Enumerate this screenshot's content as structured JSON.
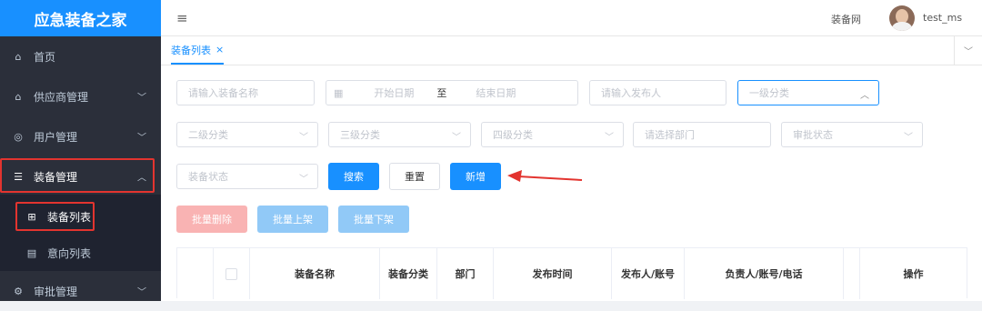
{
  "sidebar": {
    "logo": "应急装备之家",
    "items": [
      {
        "label": "首页",
        "icon": "home-icon"
      },
      {
        "label": "供应商管理",
        "icon": "home-icon"
      },
      {
        "label": "用户管理",
        "icon": "user-icon"
      },
      {
        "label": "装备管理",
        "icon": "menu-icon"
      },
      {
        "label": "装备列表",
        "icon": "grid-icon"
      },
      {
        "label": "意向列表",
        "icon": "document-icon"
      },
      {
        "label": "审批管理",
        "icon": "approval-icon"
      }
    ]
  },
  "header": {
    "site_name": "装备网",
    "username": "test_ms"
  },
  "tabs": [
    {
      "label": "装备列表",
      "close": "×"
    }
  ],
  "filters": {
    "equipment_name_placeholder": "请输入装备名称",
    "start_date_placeholder": "开始日期",
    "date_separator": "至",
    "end_date_placeholder": "结束日期",
    "publisher_placeholder": "请输入发布人",
    "level1_placeholder": "一级分类",
    "level2_placeholder": "二级分类",
    "level3_placeholder": "三级分类",
    "level4_placeholder": "四级分类",
    "department_placeholder": "请选择部门",
    "approval_status_placeholder": "审批状态",
    "equipment_status_placeholder": "装备状态"
  },
  "actions": {
    "search": "搜索",
    "reset": "重置",
    "add": "新增",
    "batch_delete": "批量删除",
    "batch_shelve": "批量上架",
    "batch_unshelve": "批量下架"
  },
  "table": {
    "columns": [
      "装备名称",
      "装备分类",
      "部门",
      "发布时间",
      "发布人/账号",
      "负责人/账号/电话",
      "操作"
    ]
  },
  "colors": {
    "primary": "#1890ff",
    "sidebar_bg": "#2b2f3a",
    "annotation_red": "#e3342f"
  }
}
